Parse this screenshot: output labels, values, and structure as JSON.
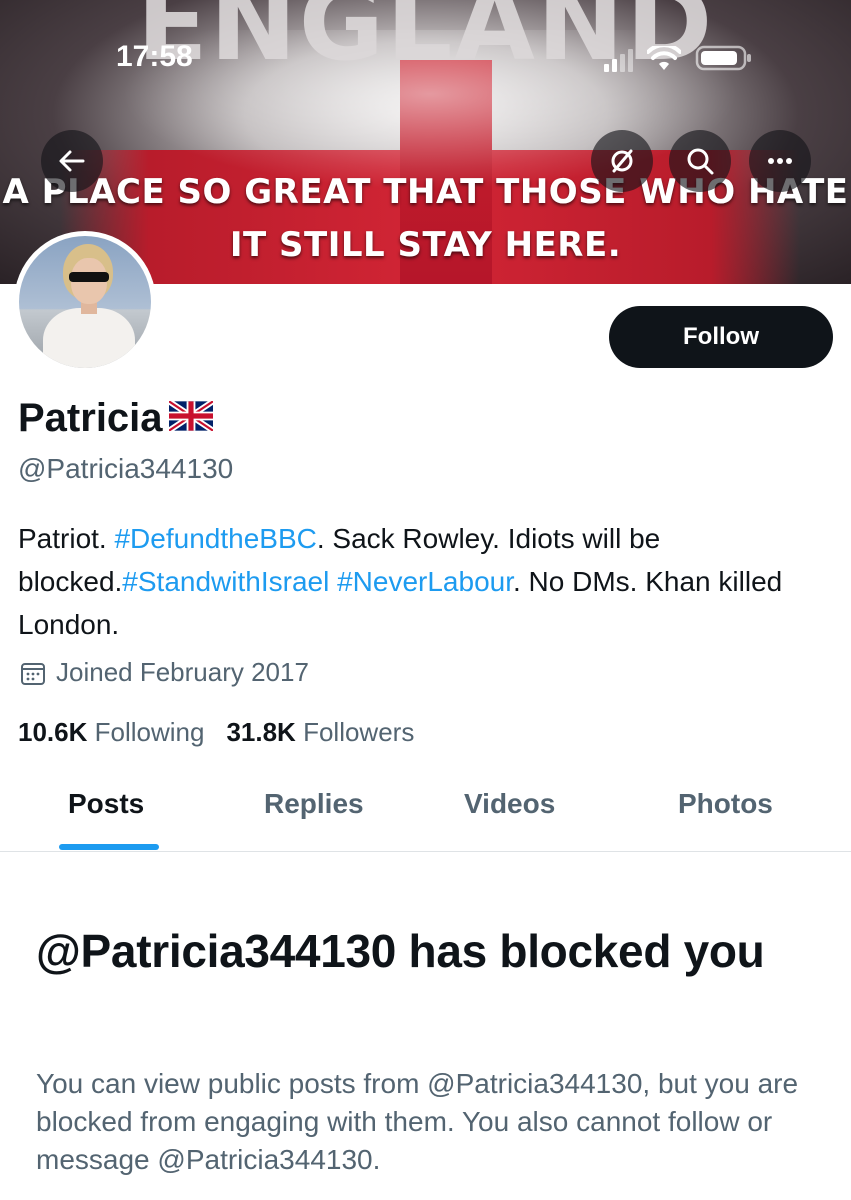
{
  "status_bar": {
    "time": "17:58"
  },
  "banner": {
    "big_word": "ENGLAND",
    "slogan_line1": "A PLACE SO GREAT THAT THOSE WHO HATE",
    "slogan_line2": "IT STILL STAY HERE."
  },
  "profile": {
    "display_name": "Patricia",
    "flag_emoji": "🇬🇧",
    "handle": "@Patricia344130",
    "bio": {
      "p1": "Patriot. ",
      "tag1": "#DefundtheBBC",
      "p2": ". Sack Rowley. Idiots will be blocked.",
      "tag2": "#StandwithIsrael",
      "p3": " ",
      "tag3": "#NeverLabour",
      "p4": ". No DMs. Khan killed London."
    },
    "joined": "Joined February 2017",
    "following_count": "10.6K",
    "following_label": "Following",
    "followers_count": "31.8K",
    "followers_label": "Followers",
    "follow_button": "Follow"
  },
  "tabs": [
    {
      "label": "Posts",
      "active": true
    },
    {
      "label": "Replies",
      "active": false
    },
    {
      "label": "Videos",
      "active": false
    },
    {
      "label": "Photos",
      "active": false
    }
  ],
  "blocked": {
    "title": "@Patricia344130 has blocked you",
    "body": "You can view public posts from @Patricia344130, but you are blocked from engaging with them. You also cannot follow or message @Patricia344130."
  },
  "icons": {
    "back": "back-arrow-icon",
    "premium": "circle-slash-icon",
    "search": "search-icon",
    "more": "more-horizontal-icon",
    "calendar": "calendar-icon"
  },
  "colors": {
    "accent": "#1d9bf0",
    "text_primary": "#0f1419",
    "text_secondary": "#536471",
    "follow_button_bg": "#0f1419"
  }
}
